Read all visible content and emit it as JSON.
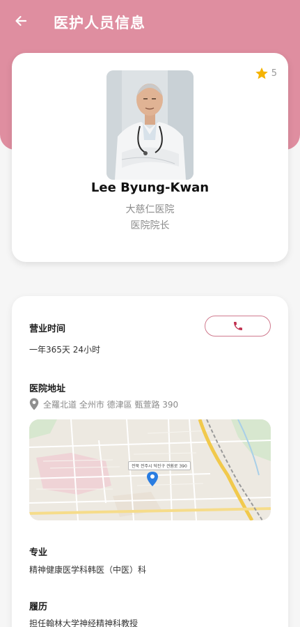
{
  "header": {
    "title": "医护人员信息",
    "back_icon": "arrow-left-icon",
    "background_color": "#df8ea0"
  },
  "profile": {
    "rating": "5",
    "star_color": "#f5b301",
    "name": "Lee Byung-Kwan",
    "hospital": "大慈仁医院",
    "position": "医院院长"
  },
  "info": {
    "hours_label": "营业时间",
    "hours_value": "一年365天 24小时",
    "call_icon": "phone-icon",
    "accent_color": "#d07a8e",
    "address_label": "医院地址",
    "address_value": "全羅北道 全州市 德津區 甄萱路 390",
    "map_pin_label": "전북 전주시 덕진구 견훤로 390",
    "specialty_label": "专业",
    "specialty_value": "精神健康医学科韩医（中医）科",
    "career_label": "履历",
    "career_value": "担任翰林大学神经精神科教授"
  }
}
